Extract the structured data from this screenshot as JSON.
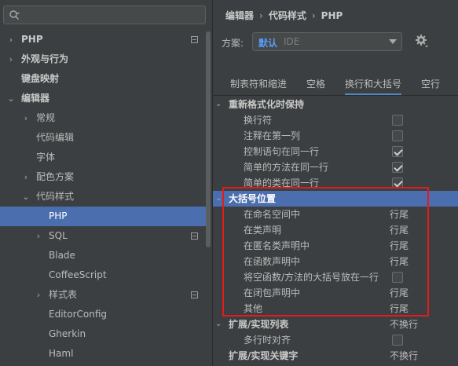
{
  "search": {
    "placeholder": ""
  },
  "tree": [
    {
      "label": "PHP",
      "indent": 0,
      "arrow": "›",
      "bold": true,
      "mark": true
    },
    {
      "label": "外观与行为",
      "indent": 0,
      "arrow": "›",
      "bold": true
    },
    {
      "label": "键盘映射",
      "indent": 0,
      "arrow": "",
      "bold": true
    },
    {
      "label": "编辑器",
      "indent": 0,
      "arrow": "⌄",
      "bold": true
    },
    {
      "label": "常规",
      "indent": 1,
      "arrow": "›"
    },
    {
      "label": "代码编辑",
      "indent": 1,
      "arrow": ""
    },
    {
      "label": "字体",
      "indent": 1,
      "arrow": ""
    },
    {
      "label": "配色方案",
      "indent": 1,
      "arrow": "›"
    },
    {
      "label": "代码样式",
      "indent": 1,
      "arrow": "⌄"
    },
    {
      "label": "PHP",
      "indent": 2,
      "arrow": "",
      "selected": true
    },
    {
      "label": "SQL",
      "indent": 2,
      "arrow": "›",
      "mark": true
    },
    {
      "label": "Blade",
      "indent": 2,
      "arrow": ""
    },
    {
      "label": "CoffeeScript",
      "indent": 2,
      "arrow": ""
    },
    {
      "label": "样式表",
      "indent": 2,
      "arrow": "›",
      "mark": true
    },
    {
      "label": "EditorConfig",
      "indent": 2,
      "arrow": ""
    },
    {
      "label": "Gherkin",
      "indent": 2,
      "arrow": ""
    },
    {
      "label": "Haml",
      "indent": 2,
      "arrow": ""
    }
  ],
  "breadcrumb": [
    "编辑器",
    "代码样式",
    "PHP"
  ],
  "scheme": {
    "label": "方案:",
    "value": "默认",
    "type": "IDE"
  },
  "tabs": [
    {
      "label": "制表符和缩进",
      "active": false
    },
    {
      "label": "空格",
      "active": false
    },
    {
      "label": "换行和大括号",
      "active": true
    },
    {
      "label": "空行",
      "active": false
    }
  ],
  "options": [
    {
      "kind": "section",
      "label": "重新格式化时保持",
      "arrow": "⌄"
    },
    {
      "kind": "item",
      "label": "换行符",
      "checkbox": false
    },
    {
      "kind": "item",
      "label": "注释在第一列",
      "checkbox": false
    },
    {
      "kind": "item",
      "label": "控制语句在同一行",
      "checkbox": true
    },
    {
      "kind": "item",
      "label": "简单的方法在同一行",
      "checkbox": true
    },
    {
      "kind": "item",
      "label": "简单的类在同一行",
      "checkbox": true
    },
    {
      "kind": "section",
      "label": "大括号位置",
      "arrow": "⌄",
      "highlight": true
    },
    {
      "kind": "item",
      "label": "在命名空间中",
      "value": "行尾"
    },
    {
      "kind": "item",
      "label": "在类声明",
      "value": "行尾"
    },
    {
      "kind": "item",
      "label": "在匿名类声明中",
      "value": "行尾"
    },
    {
      "kind": "item",
      "label": "在函数声明中",
      "value": "行尾"
    },
    {
      "kind": "item",
      "label": "将空函数/方法的大括号放在一行",
      "checkbox": false
    },
    {
      "kind": "item",
      "label": "在闭包声明中",
      "value": "行尾"
    },
    {
      "kind": "item",
      "label": "其他",
      "value": "行尾"
    },
    {
      "kind": "section",
      "label": "扩展/实现列表",
      "arrow": "⌄",
      "value": "不换行"
    },
    {
      "kind": "item",
      "label": "多行时对齐",
      "checkbox": false
    },
    {
      "kind": "section",
      "label": "扩展/实现关键字",
      "arrow": "",
      "value": "不换行"
    }
  ],
  "colors": {
    "accent": "#4b6eaf",
    "highlight_box": "#e31b1b",
    "scheme_value": "#589df6",
    "tab_underline": "#4a88c7"
  }
}
